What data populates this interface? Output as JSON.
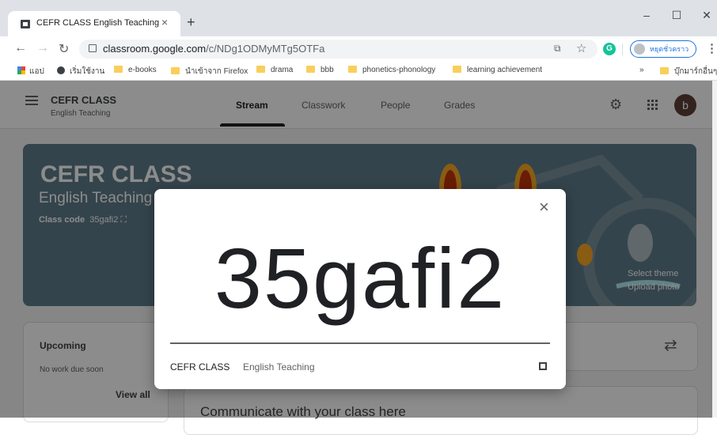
{
  "browser": {
    "tab_title": "CEFR CLASS English Teaching",
    "tab_close": "×",
    "new_tab": "+",
    "window": {
      "minimize": "–",
      "maximize": "☐",
      "close": "✕"
    },
    "url_domain": "classroom.google.com",
    "url_path": "/c/NDg1ODMyMTg5OTFa",
    "profile_label": "หยุดชั่วคราว",
    "bookmarks": [
      "แอป",
      "เริ่มใช้งาน",
      "e-books",
      "นำเข้าจาก Firefox",
      "drama",
      "bbb",
      "phonetics-phonology",
      "learning achievement"
    ],
    "bookmarks_overflow": "»",
    "other_bookmarks": "บุ๊กมาร์กอื่นๆ"
  },
  "classroom": {
    "class_name": "CEFR CLASS",
    "class_section": "English Teaching",
    "tabs": [
      "Stream",
      "Classwork",
      "People",
      "Grades"
    ],
    "avatar_letter": "b",
    "banner": {
      "title": "CEFR CLASS",
      "section": "English Teaching",
      "class_code_label": "Class code",
      "class_code": "35gafi2",
      "select_theme": "Select theme",
      "upload_photo": "Upload photo"
    },
    "upcoming": {
      "title": "Upcoming",
      "empty": "No work due soon",
      "view_all": "View all"
    },
    "communicate": "Communicate with your class here"
  },
  "dialog": {
    "close": "×",
    "code": "35gafi2",
    "class_name": "CEFR CLASS",
    "section": "English Teaching"
  }
}
